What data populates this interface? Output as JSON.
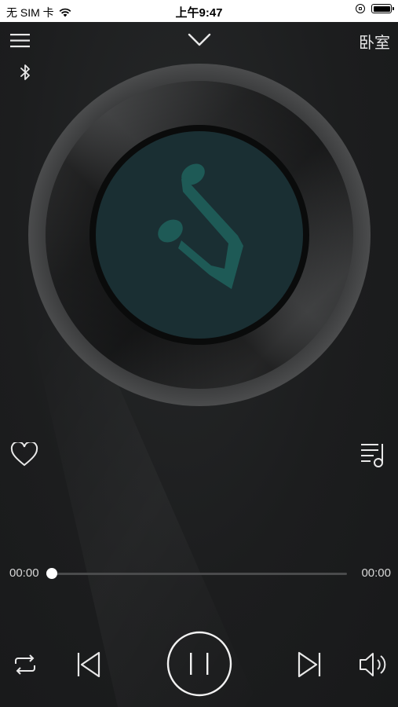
{
  "status_bar": {
    "carrier": "无 SIM 卡",
    "time": "上午9:47"
  },
  "header": {
    "menu_icon": "hamburger-menu-icon",
    "collapse_icon": "chevron-down-icon",
    "room": "卧室",
    "bluetooth_icon": "bluetooth-icon"
  },
  "player": {
    "artwork_icon": "music-note-icon",
    "favorite_icon": "heart-outline-icon",
    "playlist_icon": "playlist-icon",
    "elapsed": "00:00",
    "duration": "00:00",
    "progress": 0
  },
  "controls": {
    "repeat_icon": "repeat-icon",
    "previous_icon": "skip-previous-icon",
    "play_pause_icon": "pause-icon",
    "next_icon": "skip-next-icon",
    "volume_icon": "volume-icon"
  },
  "colors": {
    "background": "#1b1c1d",
    "artwork_bg": "#1a2f33",
    "artwork_note": "#1e5a56",
    "foreground": "#e8e8e8"
  }
}
